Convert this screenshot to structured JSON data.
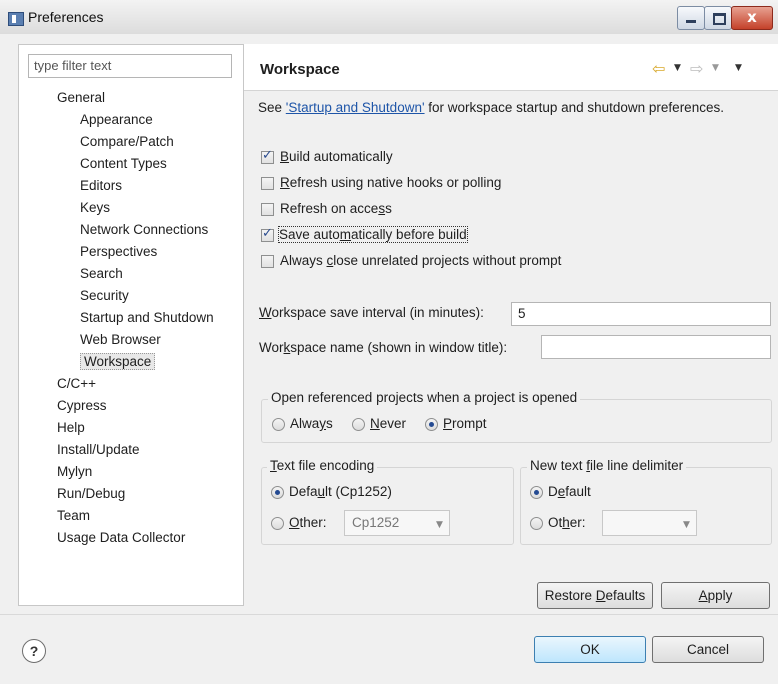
{
  "window": {
    "title": "Preferences",
    "close_glyph": "x"
  },
  "filter": {
    "placeholder": "type filter text"
  },
  "tree": {
    "items": [
      {
        "label": "General",
        "level": 0
      },
      {
        "label": "Appearance",
        "level": 1
      },
      {
        "label": "Compare/Patch",
        "level": 1
      },
      {
        "label": "Content Types",
        "level": 1
      },
      {
        "label": "Editors",
        "level": 1
      },
      {
        "label": "Keys",
        "level": 1
      },
      {
        "label": "Network Connections",
        "level": 1
      },
      {
        "label": "Perspectives",
        "level": 1
      },
      {
        "label": "Search",
        "level": 1
      },
      {
        "label": "Security",
        "level": 1
      },
      {
        "label": "Startup and Shutdown",
        "level": 1
      },
      {
        "label": "Web Browser",
        "level": 1
      },
      {
        "label": "Workspace",
        "level": 1,
        "selected": true
      },
      {
        "label": "C/C++",
        "level": 0
      },
      {
        "label": "Cypress",
        "level": 0
      },
      {
        "label": "Help",
        "level": 0
      },
      {
        "label": "Install/Update",
        "level": 0
      },
      {
        "label": "Mylyn",
        "level": 0
      },
      {
        "label": "Run/Debug",
        "level": 0
      },
      {
        "label": "Team",
        "level": 0
      },
      {
        "label": "Usage Data Collector",
        "level": 0
      }
    ]
  },
  "page": {
    "title": "Workspace",
    "desc_prefix": "See ",
    "desc_link": "'Startup and Shutdown'",
    "desc_suffix": " for workspace startup and shutdown preferences."
  },
  "checkboxes": [
    {
      "pre": "",
      "u": "B",
      "post": "uild automatically",
      "checked": true
    },
    {
      "pre": "",
      "u": "R",
      "post": "efresh using native hooks or polling",
      "checked": false
    },
    {
      "pre": "Refresh on acce",
      "u": "s",
      "post": "s",
      "checked": false
    },
    {
      "pre": "Save auto",
      "u": "m",
      "post": "atically before build",
      "checked": true
    },
    {
      "pre": "Always ",
      "u": "c",
      "post": "lose unrelated projects without prompt",
      "checked": false
    }
  ],
  "save_interval": {
    "pre": "",
    "u": "W",
    "post": "orkspace save interval (in minutes):",
    "value": "5"
  },
  "workspace_name": {
    "pre": "Wor",
    "u": "k",
    "post": "space name (shown in window title):",
    "value": ""
  },
  "open_referenced": {
    "title": "Open referenced projects when a project is opened",
    "options": [
      {
        "pre": "Alwa",
        "u": "y",
        "post": "s",
        "selected": false
      },
      {
        "pre": "",
        "u": "N",
        "post": "ever",
        "selected": false
      },
      {
        "pre": "",
        "u": "P",
        "post": "rompt",
        "selected": true
      }
    ]
  },
  "encoding": {
    "title_u": "T",
    "title_post": "ext file encoding",
    "default_pre": "Defa",
    "default_u": "u",
    "default_post": "lt (Cp1252)",
    "default_selected": true,
    "other_u": "O",
    "other_post": "ther:",
    "other_value": "Cp1252"
  },
  "delimiter": {
    "title_pre": "New text ",
    "title_u": "f",
    "title_post": "ile line delimiter",
    "default_pre": "D",
    "default_u": "e",
    "default_post": "fault",
    "default_selected": true,
    "other_pre": "Ot",
    "other_u": "h",
    "other_post": "er:",
    "other_value": ""
  },
  "buttons": {
    "restore_pre": "Restore ",
    "restore_u": "D",
    "restore_post": "efaults",
    "apply_u": "A",
    "apply_post": "pply",
    "ok": "OK",
    "cancel": "Cancel"
  },
  "help_glyph": "?",
  "nav": {
    "back": "⇦",
    "forward": "⇨",
    "drop": "▼"
  }
}
